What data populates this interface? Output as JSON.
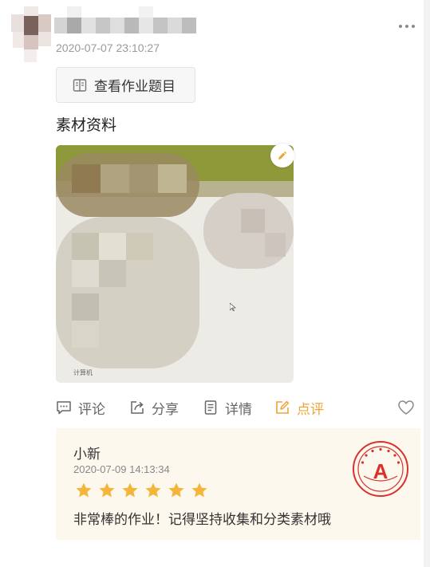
{
  "post": {
    "timestamp": "2020-07-07 23:10:27",
    "view_button_label": "查看作业题目",
    "section_title": "素材资料",
    "photo_desktop_label": "计算机"
  },
  "actions": {
    "comment": "评论",
    "share": "分享",
    "details": "详情",
    "review": "点评"
  },
  "review": {
    "teacher_name": "小新",
    "timestamp": "2020-07-09 14:13:34",
    "rating": 6,
    "rating_max": 6,
    "comment": "非常棒的作业！记得坚持收集和分类素材哦",
    "stamp_grade": "A"
  },
  "colors": {
    "accent_orange": "#f0a436",
    "star": "#f3b63b",
    "stamp_red": "#d9312c",
    "card_bg": "#fdf8ee"
  },
  "icons": [
    "more-icon",
    "book-icon",
    "edit-pencil-icon",
    "comment-icon",
    "share-icon",
    "details-icon",
    "review-icon",
    "heart-icon",
    "star-icon",
    "grade-stamp-icon"
  ]
}
